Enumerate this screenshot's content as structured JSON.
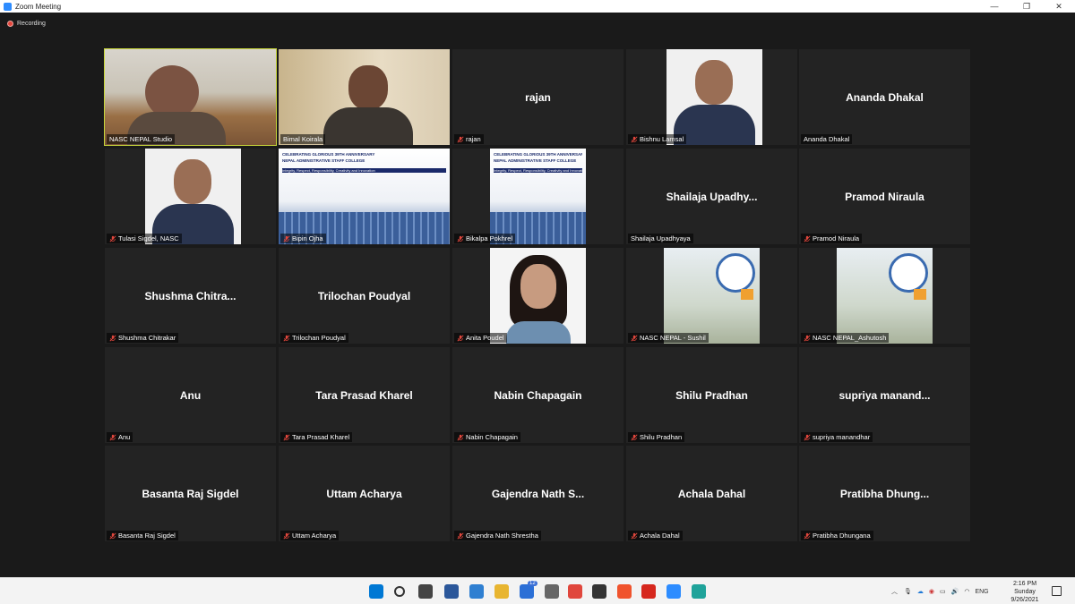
{
  "window": {
    "title": "Zoom Meeting",
    "minimize": "—",
    "restore": "❐",
    "close": "✕"
  },
  "recording": {
    "label": "Recording"
  },
  "colors": {
    "active_border": "#c8d63a",
    "tile_bg": "#232323",
    "muted_mic": "#e0463c"
  },
  "tiles": [
    {
      "id": "t1",
      "label": "NASC NEPAL Studio",
      "type": "video",
      "muted": false,
      "active": true
    },
    {
      "id": "t2",
      "label": "Bimal Koirala",
      "type": "video",
      "muted": false
    },
    {
      "id": "t3",
      "label": "rajan",
      "center": "rajan",
      "muted": true
    },
    {
      "id": "t4",
      "label": "Bishnu Lamsal",
      "type": "photo",
      "muted": true
    },
    {
      "id": "t5",
      "label": "Ananda Dhakal",
      "center": "Ananda Dhakal",
      "muted": false
    },
    {
      "id": "t6",
      "label": "Tulasi Sigdel, NASC",
      "type": "photo",
      "muted": true
    },
    {
      "id": "t7",
      "label": "Bipin Ojha",
      "type": "banner",
      "muted": true
    },
    {
      "id": "t8",
      "label": "Bikalpa Pokhrel",
      "type": "banner",
      "muted": true
    },
    {
      "id": "t9",
      "label": "Shailaja Upadhyaya",
      "center": "Shailaja  Upadhy...",
      "muted": false
    },
    {
      "id": "t10",
      "label": "Pramod Niraula",
      "center": "Pramod Niraula",
      "muted": true
    },
    {
      "id": "t11",
      "label": "Shushma Chitrakar",
      "center": "Shushma  Chitra...",
      "muted": true
    },
    {
      "id": "t12",
      "label": "Trilochan Poudyal",
      "center": "Trilochan Poudyal",
      "muted": true
    },
    {
      "id": "t13",
      "label": "Anita Poudel",
      "type": "photo",
      "muted": true
    },
    {
      "id": "t14",
      "label": "NASC NEPAL - Sushil",
      "type": "logo",
      "muted": true
    },
    {
      "id": "t15",
      "label": "NASC NEPAL_Ashutosh",
      "type": "logo",
      "muted": true
    },
    {
      "id": "t16",
      "label": "Anu",
      "center": "Anu",
      "muted": true
    },
    {
      "id": "t17",
      "label": "Tara Prasad Kharel",
      "center": "Tara Prasad Kharel",
      "muted": true
    },
    {
      "id": "t18",
      "label": "Nabin Chapagain",
      "center": "Nabin Chapagain",
      "muted": true
    },
    {
      "id": "t19",
      "label": "Shilu Pradhan",
      "center": "Shilu Pradhan",
      "muted": true
    },
    {
      "id": "t20",
      "label": "supriya manandhar",
      "center": "supriya  manand...",
      "muted": true
    },
    {
      "id": "t21",
      "label": "Basanta Raj Sigdel",
      "center": "Basanta Raj Sigdel",
      "muted": true
    },
    {
      "id": "t22",
      "label": "Uttam Acharya",
      "center": "Uttam Acharya",
      "muted": true
    },
    {
      "id": "t23",
      "label": "Gajendra Nath Shrestha",
      "center": "Gajendra  Nath  S...",
      "muted": true
    },
    {
      "id": "t24",
      "label": "Achala Dahal",
      "center": "Achala Dahal",
      "muted": true
    },
    {
      "id": "t25",
      "label": "Pratibha Dhungana",
      "center": "Pratibha  Dhung...",
      "muted": true
    }
  ],
  "banner": {
    "line1": "CELEBRATING GLORIOUS 39TH ANNIVERSARY",
    "line2": "NEPAL ADMINISTRATIVE STAFF COLLEGE",
    "line3": "Integrity, Respect, Responsibility, Creativity and Innovation"
  },
  "taskbar": {
    "icons": [
      "windows-start-icon",
      "search-icon",
      "task-view-icon",
      "widgets-icon",
      "edge-icon",
      "file-explorer-icon",
      "mail-icon",
      "settings-icon",
      "app-icon",
      "app2-icon",
      "brave-icon",
      "acrobat-icon",
      "zoom-icon",
      "app3-icon"
    ],
    "mail_badge": "12",
    "language": "ENG",
    "time": "2:16 PM",
    "day": "Sunday",
    "date": "9/26/2021"
  }
}
